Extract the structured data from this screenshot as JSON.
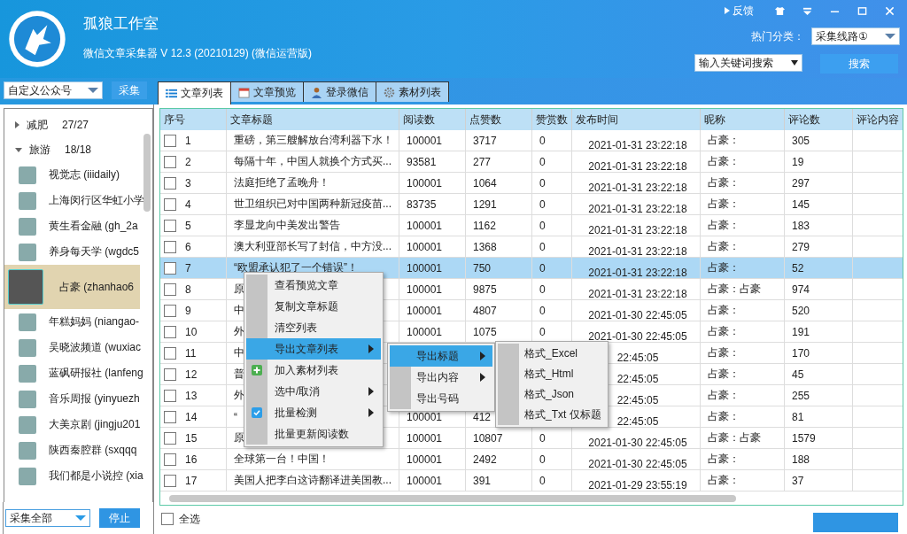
{
  "header": {
    "title": "孤狼工作室",
    "subtitle": "微信文章采集器  V 12.3 (20210129) (微信运营版)",
    "feedback": "反馈",
    "category_label": "热门分类：",
    "category_select": "采集线路①",
    "search_select": "输入关键词搜索",
    "search_button": "搜索"
  },
  "source": {
    "select": "自定义公众号",
    "button": "采集"
  },
  "tabs": [
    {
      "label": "文章列表",
      "selected": true
    },
    {
      "label": "文章预览",
      "selected": false
    },
    {
      "label": "登录微信",
      "selected": false
    },
    {
      "label": "素材列表",
      "selected": false
    }
  ],
  "sidebar": {
    "groups": [
      {
        "name": "减肥",
        "count": "27/27",
        "expanded": false
      },
      {
        "name": "旅游",
        "count": "18/18",
        "expanded": true,
        "children": [
          {
            "name": "视觉志 (iiidaily)",
            "selected": false
          },
          {
            "name": "上海闵行区华虹小学",
            "selected": false
          },
          {
            "name": "黄生看金融 (gh_2a",
            "selected": false
          },
          {
            "name": "养身每天学 (wgdc5",
            "selected": false
          },
          {
            "name": "占豪 (zhanhao6",
            "selected": true
          },
          {
            "name": "年糕妈妈 (niangao-",
            "selected": false
          },
          {
            "name": "吴晓波频道 (wuxiac",
            "selected": false
          },
          {
            "name": "蓝砜研报社 (lanfeng",
            "selected": false
          },
          {
            "name": "音乐周报 (yinyuezh",
            "selected": false
          },
          {
            "name": "大美京剧 (jingju201",
            "selected": false
          },
          {
            "name": "陕西秦腔群 (sxqqq",
            "selected": false
          },
          {
            "name": "我们都是小说控 (xia",
            "selected": false
          }
        ]
      }
    ],
    "scope_select": "采集全部",
    "stop_button": "停止"
  },
  "table": {
    "columns": [
      "序号",
      "文章标题",
      "阅读数",
      "点赞数",
      "赞赏数",
      "发布时间",
      "昵称",
      "评论数",
      "评论内容"
    ],
    "rows": [
      {
        "seq": "1",
        "checked": false,
        "selected": false,
        "title": "重磅，第三艘解放台湾利器下水！",
        "reads": "100001",
        "likes": "3717",
        "tips": "0",
        "date": "2021-01-31 23:22:18",
        "nickname": "占豪：",
        "comments": "305"
      },
      {
        "seq": "2",
        "checked": false,
        "selected": false,
        "title": "每隔十年，中国人就换个方式买...",
        "reads": "93581",
        "likes": "277",
        "tips": "0",
        "date": "2021-01-31 23:22:18",
        "nickname": "占豪：",
        "comments": "19"
      },
      {
        "seq": "3",
        "checked": false,
        "selected": false,
        "title": "法庭拒绝了孟晚舟！",
        "reads": "100001",
        "likes": "1064",
        "tips": "0",
        "date": "2021-01-31 23:22:18",
        "nickname": "占豪：",
        "comments": "297"
      },
      {
        "seq": "4",
        "checked": false,
        "selected": false,
        "title": "世卫组织已对中国两种新冠疫苗...",
        "reads": "83735",
        "likes": "1291",
        "tips": "0",
        "date": "2021-01-31 23:22:18",
        "nickname": "占豪：",
        "comments": "145"
      },
      {
        "seq": "5",
        "checked": false,
        "selected": false,
        "title": "李显龙向中美发出警告",
        "reads": "100001",
        "likes": "1162",
        "tips": "0",
        "date": "2021-01-31 23:22:18",
        "nickname": "占豪：",
        "comments": "183"
      },
      {
        "seq": "6",
        "checked": false,
        "selected": false,
        "title": "澳大利亚部长写了封信，中方没...",
        "reads": "100001",
        "likes": "1368",
        "tips": "0",
        "date": "2021-01-31 23:22:18",
        "nickname": "占豪：",
        "comments": "279"
      },
      {
        "seq": "7",
        "checked": false,
        "selected": true,
        "title": "“欧盟承认犯了一个错误”！",
        "reads": "100001",
        "likes": "750",
        "tips": "0",
        "date": "2021-01-31 23:22:18",
        "nickname": "占豪：",
        "comments": "52"
      },
      {
        "seq": "8",
        "checked": false,
        "selected": false,
        "title": "原",
        "reads": "100001",
        "likes": "9875",
        "tips": "0",
        "date": "2021-01-31 23:22:18",
        "nickname": "占豪：占豪",
        "comments": "974"
      },
      {
        "seq": "9",
        "checked": false,
        "selected": false,
        "title": "中",
        "reads": "100001",
        "likes": "4807",
        "tips": "0",
        "date": "2021-01-30 22:45:05",
        "nickname": "占豪：",
        "comments": "520"
      },
      {
        "seq": "10",
        "checked": false,
        "selected": false,
        "title": "外",
        "reads": "100001",
        "likes": "1075",
        "tips": "0",
        "date": "2021-01-30 22:45:05",
        "nickname": "占豪：",
        "comments": "191"
      },
      {
        "seq": "11",
        "checked": false,
        "selected": false,
        "title": "中",
        "date": "22:45:05",
        "nickname": "占豪：",
        "comments": "170"
      },
      {
        "seq": "12",
        "checked": false,
        "selected": false,
        "title": "普",
        "date": "22:45:05",
        "nickname": "占豪：",
        "comments": "45"
      },
      {
        "seq": "13",
        "checked": false,
        "selected": false,
        "title": "外",
        "date": "22:45:05",
        "nickname": "占豪：",
        "comments": "255"
      },
      {
        "seq": "14",
        "checked": false,
        "selected": false,
        "title": "“",
        "reads": "100001",
        "likes": "412",
        "date": "22:45:05",
        "nickname": "占豪：",
        "comments": "81"
      },
      {
        "seq": "15",
        "checked": false,
        "selected": false,
        "title": "原",
        "reads": "100001",
        "likes": "10807",
        "tips": "0",
        "date": "2021-01-30 22:45:05",
        "nickname": "占豪：占豪",
        "comments": "1579"
      },
      {
        "seq": "16",
        "checked": false,
        "selected": false,
        "title": "全球第一台！中国！",
        "reads": "100001",
        "likes": "2492",
        "tips": "0",
        "date": "2021-01-30 22:45:05",
        "nickname": "占豪：",
        "comments": "188"
      },
      {
        "seq": "17",
        "checked": false,
        "selected": false,
        "title": "美国人把李白这诗翻译进美国教...",
        "reads": "100001",
        "likes": "391",
        "tips": "0",
        "date": "2021-01-29 23:55:19",
        "nickname": "占豪：",
        "comments": "37"
      }
    ]
  },
  "footer": {
    "select_all": {
      "label": "全选",
      "checked": false
    }
  },
  "context_menu": {
    "items": [
      {
        "label": "查看预览文章",
        "kind": "plain",
        "submenu": false,
        "selected": false
      },
      {
        "label": "复制文章标题",
        "kind": "plain",
        "submenu": false,
        "selected": false
      },
      {
        "label": "清空列表",
        "kind": "plain",
        "submenu": false,
        "selected": false
      },
      {
        "label": "导出文章列表",
        "kind": "plain",
        "submenu": true,
        "selected": true
      },
      {
        "label": "加入素材列表",
        "kind": "add",
        "submenu": false,
        "selected": false
      },
      {
        "label": "选中/取消",
        "kind": "plain",
        "submenu": true,
        "selected": false
      },
      {
        "label": "批量检测",
        "kind": "toggle",
        "submenu": true,
        "selected": false
      },
      {
        "label": "批量更新阅读数",
        "kind": "plain",
        "submenu": false,
        "selected": false
      }
    ]
  },
  "export_menu": {
    "items": [
      {
        "label": "导出标题",
        "submenu": true,
        "selected": true
      },
      {
        "label": "导出内容",
        "submenu": true,
        "selected": false
      },
      {
        "label": "导出号码",
        "submenu": false,
        "selected": false
      }
    ]
  },
  "format_menu": {
    "items": [
      {
        "label": "格式_Excel",
        "selected": false
      },
      {
        "label": "格式_Html",
        "selected": false
      },
      {
        "label": "格式_Json",
        "selected": false
      },
      {
        "label": "格式_Txt 仅标题",
        "selected": false
      }
    ]
  }
}
